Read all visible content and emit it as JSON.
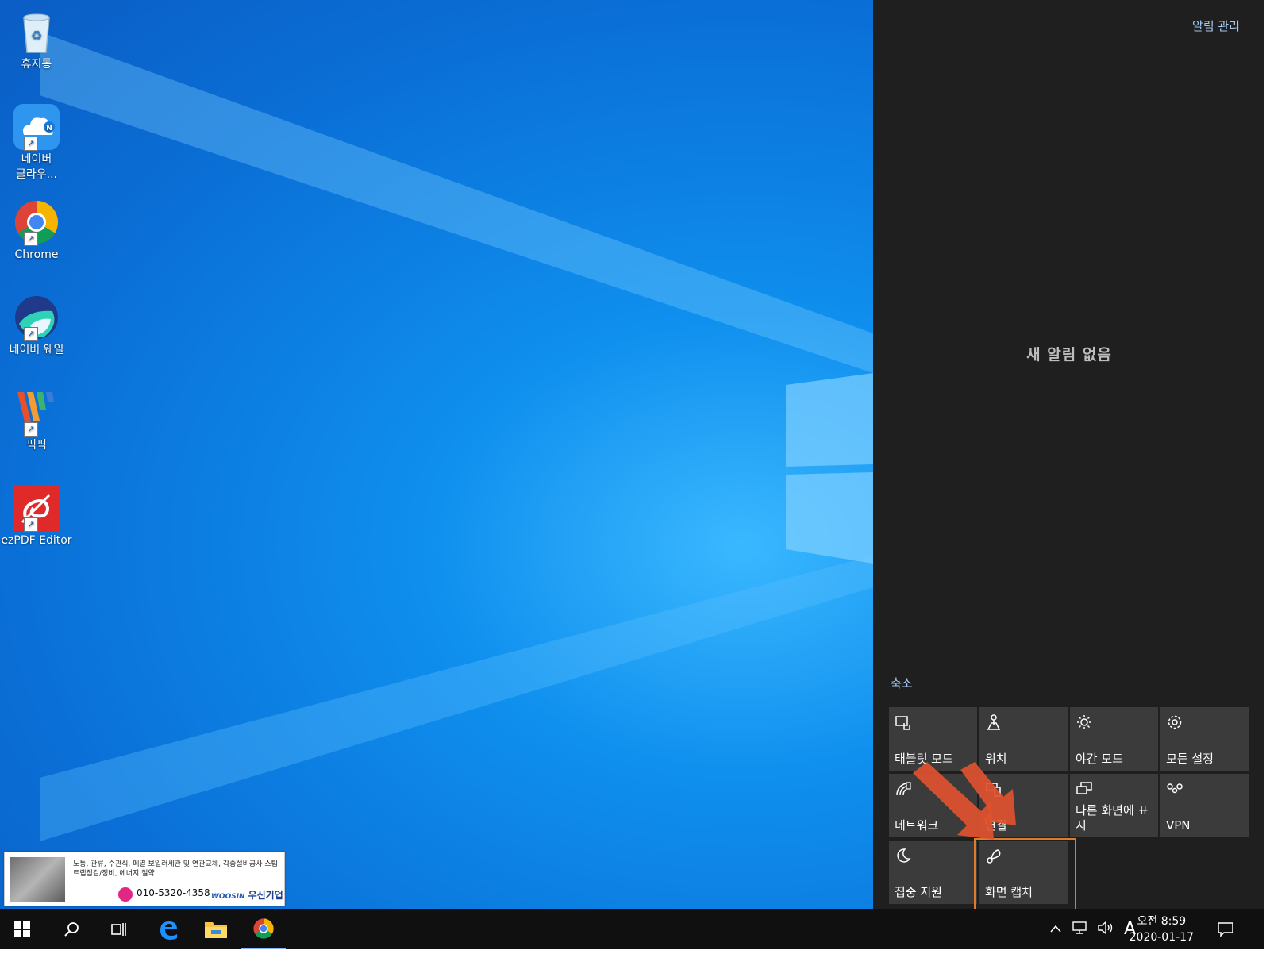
{
  "desktop": {
    "icons": [
      {
        "label": "휴지통",
        "icon": "recycle-bin-icon"
      },
      {
        "label": "네이버\n클라우...",
        "icon": "naver-cloud-icon"
      },
      {
        "label": "Chrome",
        "icon": "chrome-icon"
      },
      {
        "label": "네이버 웨일",
        "icon": "naver-whale-icon"
      },
      {
        "label": "픽픽",
        "icon": "picpick-icon"
      },
      {
        "label": "ezPDF Editor",
        "icon": "ezpdf-icon"
      }
    ]
  },
  "ad": {
    "text": "노통, 관류, 수관식, 폐열 보일러세관 및 연관교체, 각종설비공사 스팀트랩점검/정비, 에너지 절약!",
    "phone": "010-5320-4358",
    "brand_small": "WOOSIN",
    "brand": "우신기업"
  },
  "action_center": {
    "manage_label": "알림 관리",
    "empty_label": "새 알림 없음",
    "collapse_label": "축소",
    "tiles": [
      {
        "label": "태블릿 모드",
        "icon": "tablet-mode-icon"
      },
      {
        "label": "위치",
        "icon": "location-icon"
      },
      {
        "label": "야간 모드",
        "icon": "night-light-icon"
      },
      {
        "label": "모든 설정",
        "icon": "settings-icon"
      },
      {
        "label": "네트워크",
        "icon": "network-icon"
      },
      {
        "label": "연결",
        "icon": "connect-icon"
      },
      {
        "label": "다른 화면에 표시",
        "icon": "project-icon"
      },
      {
        "label": "VPN",
        "icon": "vpn-icon"
      },
      {
        "label": "집중 지원",
        "icon": "focus-assist-icon"
      },
      {
        "label": "화면 캡처",
        "icon": "screen-snip-icon"
      }
    ],
    "highlight_color": "#e07b2a",
    "arrow_color": "#e0522f"
  },
  "taskbar": {
    "ime_label": "A",
    "time": "오전 8:59",
    "date": "2020-01-17"
  }
}
